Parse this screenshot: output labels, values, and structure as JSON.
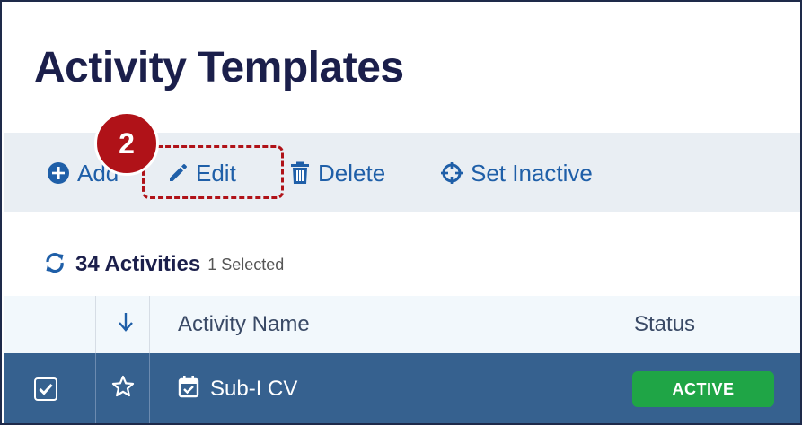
{
  "header": {
    "title": "Activity Templates"
  },
  "toolbar": {
    "add_label": "Add",
    "edit_label": "Edit",
    "delete_label": "Delete",
    "set_inactive_label": "Set Inactive"
  },
  "annotation": {
    "step_number": "2",
    "color": "#b01218"
  },
  "summary": {
    "count_label": "34 Activities",
    "selected_label": "1 Selected"
  },
  "table": {
    "columns": [
      "Activity Name",
      "Status"
    ],
    "rows": [
      {
        "name": "Sub-I CV",
        "status": "ACTIVE",
        "checked": true
      }
    ]
  },
  "colors": {
    "title": "#1b1f4b",
    "toolbar_text": "#1f5fa8",
    "selected_row": "#36618f",
    "active_badge": "#1fa546"
  },
  "icons": [
    "plus-circle-icon",
    "pencil-icon",
    "trash-icon",
    "crosshair-icon",
    "refresh-icon",
    "sort-down-arrow-icon",
    "checkbox-checked-icon",
    "star-outline-icon",
    "calendar-check-icon"
  ]
}
